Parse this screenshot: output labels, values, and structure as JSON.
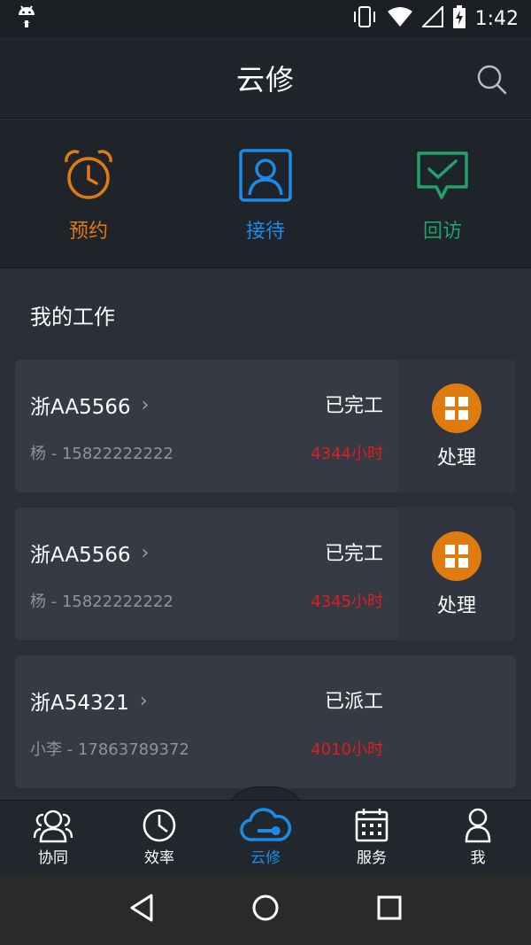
{
  "status_bar": {
    "time": "1:42"
  },
  "app_bar": {
    "title": "云修"
  },
  "shortcuts": [
    {
      "label": "预约",
      "color": "#e07b10",
      "icon": "alarm-clock-icon"
    },
    {
      "label": "接待",
      "color": "#1a8ce8",
      "icon": "person-frame-icon"
    },
    {
      "label": "回访",
      "color": "#1fa36c",
      "icon": "message-check-icon"
    }
  ],
  "section": {
    "title": "我的工作"
  },
  "work_orders": [
    {
      "plate": "浙AA5566",
      "status": "已完工",
      "contact": "杨 - 15822222222",
      "hours": "4344小时",
      "action": "处理"
    },
    {
      "plate": "浙AA5566",
      "status": "已完工",
      "contact": "杨 - 15822222222",
      "hours": "4345小时",
      "action": "处理"
    },
    {
      "plate": "浙A54321",
      "status": "已派工",
      "contact": "小李 - 17863789372",
      "hours": "4010小时"
    }
  ],
  "tabs": [
    {
      "label": "协同",
      "icon": "people-icon"
    },
    {
      "label": "效率",
      "icon": "clock-icon"
    },
    {
      "label": "云修",
      "icon": "cloud-wrench-icon",
      "active": true
    },
    {
      "label": "服务",
      "icon": "calendar-icon"
    },
    {
      "label": "我",
      "icon": "person-icon"
    }
  ],
  "colors": {
    "accent": "#1a8ce8",
    "orange": "#e07b10",
    "green": "#1fa36c",
    "alert": "#e01e1e"
  }
}
